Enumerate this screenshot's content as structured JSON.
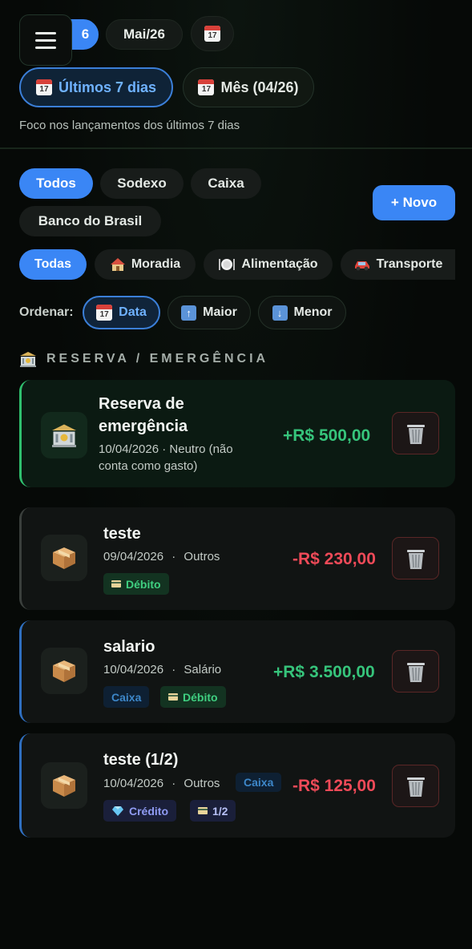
{
  "header": {
    "menu_icon": "hamburger-menu-icon",
    "months": {
      "current_partial": "6",
      "next": "Mai/26",
      "calendar_icon": "calendar-icon"
    },
    "periods": {
      "last7": "Últimos 7 dias",
      "month": "Mês (04/26)"
    },
    "subtitle": "Foco nos lançamentos dos últimos 7 dias"
  },
  "accounts": {
    "items": [
      "Todos",
      "Sodexo",
      "Caixa",
      "Banco do Brasil"
    ],
    "selected": "Todos",
    "new_button": "+ Novo"
  },
  "categories": {
    "items": [
      {
        "label": "Todas",
        "icon": ""
      },
      {
        "label": "Moradia",
        "icon": "house-icon"
      },
      {
        "label": "Alimentação",
        "icon": "plate-icon"
      },
      {
        "label": "Transporte",
        "icon": "car-icon"
      }
    ],
    "selected": "Todas"
  },
  "sort": {
    "label": "Ordenar:",
    "options": [
      "Data",
      "Maior",
      "Menor"
    ],
    "selected": "Data"
  },
  "section": {
    "title": "RESERVA / EMERGÊNCIA",
    "icon": "bank-icon"
  },
  "transactions": [
    {
      "title_line1": "Reserva de",
      "title_line2": "emergência",
      "meta_line1": "10/04/2026 · Neutro (não",
      "meta_line2": "conta como gasto)",
      "amount": "+R$ 500,00",
      "icon": "bank-icon"
    },
    {
      "title": "teste",
      "date": "09/04/2026",
      "category": "Outros",
      "amount": "-R$ 230,00",
      "tags": [
        "Débito"
      ],
      "icon": "package-icon"
    },
    {
      "title": "salario",
      "date": "10/04/2026",
      "category": "Salário",
      "amount": "+R$ 3.500,00",
      "tags": [
        "Caixa",
        "Débito"
      ],
      "icon": "package-icon"
    },
    {
      "title": "teste (1/2)",
      "date": "10/04/2026",
      "category": "Outros",
      "account": "Caixa",
      "amount": "-R$ 125,00",
      "tags": [
        "Crédito",
        "1/2"
      ],
      "icon": "package-icon"
    }
  ],
  "colors": {
    "accent": "#3a86f5",
    "positive": "#36c47b",
    "negative": "#ef4a58"
  }
}
